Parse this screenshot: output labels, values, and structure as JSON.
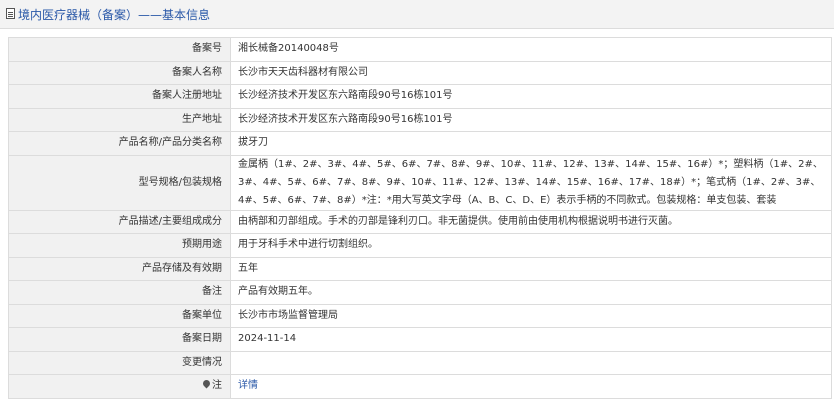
{
  "header": {
    "title": "境内医疗器械（备案）——基本信息"
  },
  "rows": [
    {
      "label": "备案号",
      "value": "湘长械备20140048号"
    },
    {
      "label": "备案人名称",
      "value": "长沙市天天齿科器材有限公司"
    },
    {
      "label": "备案人注册地址",
      "value": "长沙经济技术开发区东六路南段90号16栋101号"
    },
    {
      "label": "生产地址",
      "value": "长沙经济技术开发区东六路南段90号16栋101号"
    },
    {
      "label": "产品名称/产品分类名称",
      "value": "拔牙刀"
    },
    {
      "label": "型号规格/包装规格",
      "value": "金属柄（1#、2#、3#、4#、5#、6#、7#、8#、9#、10#、11#、12#、13#、14#、15#、16#）*；塑料柄（1#、2#、3#、4#、5#、6#、7#、8#、9#、10#、11#、12#、13#、14#、15#、16#、17#、18#）*；笔式柄（1#、2#、3#、4#、5#、6#、7#、8#）*注：*用大写英文字母（A、B、C、D、E）表示手柄的不同款式。包装规格：单支包装、套装"
    },
    {
      "label": "产品描述/主要组成成分",
      "value": "由柄部和刃部组成。手术的刃部是锋利刃口。非无菌提供。使用前由使用机构根据说明书进行灭菌。"
    },
    {
      "label": "预期用途",
      "value": "用于牙科手术中进行切割组织。"
    },
    {
      "label": "产品存储及有效期",
      "value": "五年"
    },
    {
      "label": "备注",
      "value": "产品有效期五年。"
    },
    {
      "label": "备案单位",
      "value": "长沙市市场监督管理局"
    },
    {
      "label": "备案日期",
      "value": "2024-11-14"
    },
    {
      "label": "变更情况",
      "value": ""
    }
  ],
  "note_row": {
    "label": "注",
    "icon": "pin-icon",
    "link_label": "详情"
  },
  "colors": {
    "link": "#2a58a8",
    "label_bg": "#f1f1f1",
    "border": "#dcdcdc"
  }
}
